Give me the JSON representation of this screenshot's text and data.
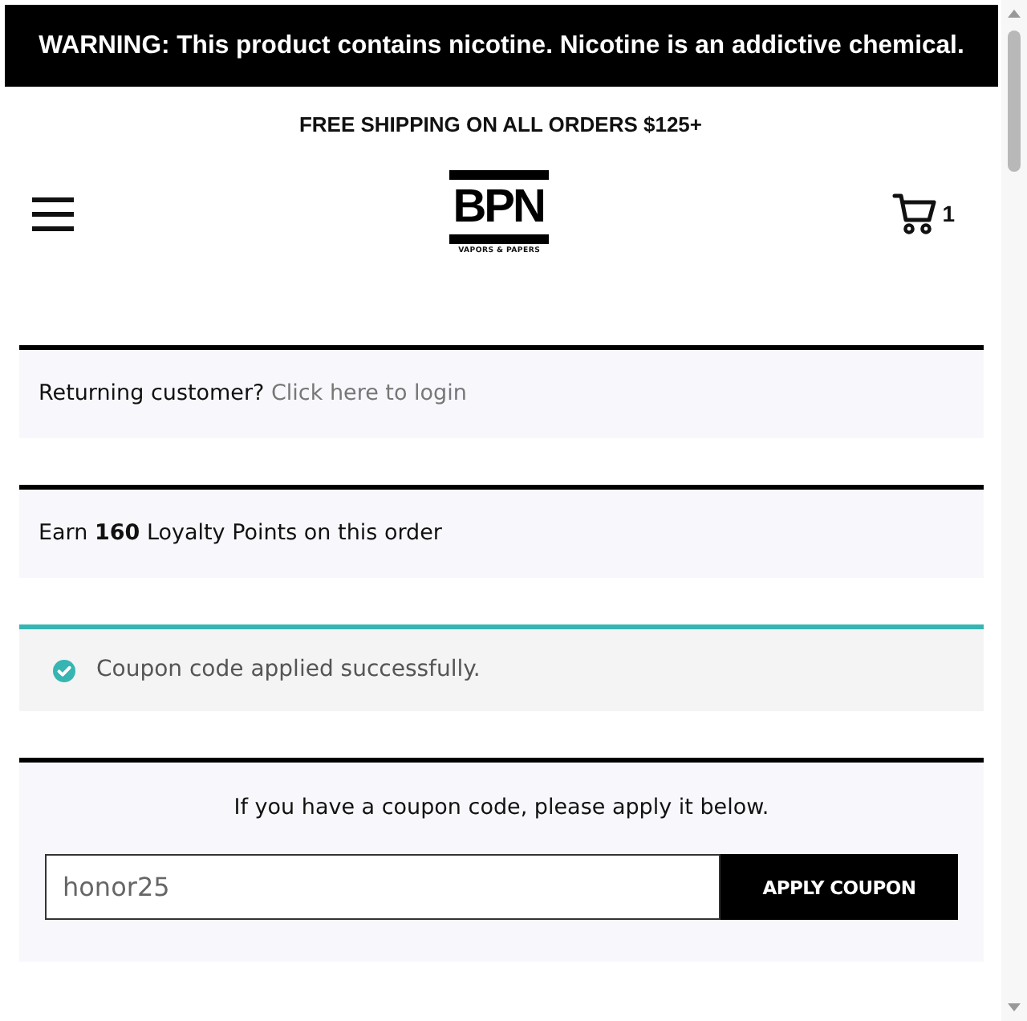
{
  "warning_bar": {
    "text": "WARNING: This product contains nicotine. Nicotine is an addictive chemical."
  },
  "promo_bar": {
    "text": "FREE SHIPPING ON ALL ORDERS $125+"
  },
  "header": {
    "logo": {
      "text": "BPN",
      "tagline": "VAPORS & PAPERS"
    },
    "cart": {
      "count": "1"
    }
  },
  "notices": [
    {
      "kind": "login",
      "text": "Returning customer?",
      "link": "Click here to login"
    },
    {
      "kind": "loyalty",
      "text": "Earn **160** Loyalty Points on this order"
    },
    {
      "kind": "success",
      "text": "Coupon code applied successfully."
    }
  ],
  "coupon_form": {
    "prompt": "If you have a coupon code, please apply it below.",
    "field": {
      "value": "honor25"
    },
    "button": "APPLY COUPON"
  }
}
